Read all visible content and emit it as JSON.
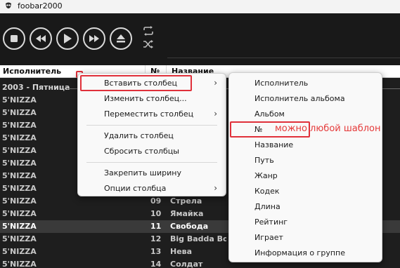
{
  "window": {
    "title": "foobar2000"
  },
  "toolbar": {
    "buttons": [
      {
        "name": "stop-button",
        "icon": "stop-icon"
      },
      {
        "name": "previous-button",
        "icon": "previous-icon"
      },
      {
        "name": "play-button",
        "icon": "play-icon"
      },
      {
        "name": "next-button",
        "icon": "next-icon"
      },
      {
        "name": "eject-button",
        "icon": "eject-icon"
      }
    ],
    "order_icons": [
      "repeat-icon",
      "shuffle-icon"
    ]
  },
  "columns": {
    "artist": "Исполнитель",
    "number": "№",
    "title": "Название"
  },
  "group": {
    "label": "2003 - Пятница"
  },
  "rows": [
    {
      "artist": "5'NIZZA",
      "number": "",
      "title": ""
    },
    {
      "artist": "5'NIZZA",
      "number": "",
      "title": ""
    },
    {
      "artist": "5'NIZZA",
      "number": "",
      "title": ""
    },
    {
      "artist": "5'NIZZA",
      "number": "",
      "title": ""
    },
    {
      "artist": "5'NIZZA",
      "number": "",
      "title": ""
    },
    {
      "artist": "5'NIZZA",
      "number": "",
      "title": ""
    },
    {
      "artist": "5'NIZZA",
      "number": "",
      "title": ""
    },
    {
      "artist": "5'NIZZA",
      "number": "",
      "title": ""
    },
    {
      "artist": "5'NIZZA",
      "number": "09",
      "title": "Стрела"
    },
    {
      "artist": "5'NIZZA",
      "number": "10",
      "title": "Ямайка"
    },
    {
      "artist": "5'NIZZA",
      "number": "11",
      "title": "Свобода"
    },
    {
      "artist": "5'NIZZA",
      "number": "12",
      "title": "Big Badda Boom"
    },
    {
      "artist": "5'NIZZA",
      "number": "13",
      "title": "Нева"
    },
    {
      "artist": "5'NIZZA",
      "number": "14",
      "title": "Солдат"
    }
  ],
  "context_menu": {
    "insert_column": "Вставить столбец",
    "edit_column": "Изменить столбец...",
    "move_column": "Переместить столбец",
    "delete_column": "Удалить столбец",
    "reset_columns": "Сбросить столбцы",
    "pin_width": "Закрепить ширину",
    "column_options": "Опции столбца",
    "submenu_arrow": "›"
  },
  "submenu": {
    "items": [
      "Исполнитель",
      "Исполнитель альбома",
      "Альбом",
      "№",
      "Название",
      "Путь",
      "Жанр",
      "Кодек",
      "Длина",
      "Рейтинг",
      "Играет",
      "Информация о группе"
    ]
  },
  "annotation": {
    "text": "можно любой шаблон",
    "color": "#e53a3a"
  },
  "colors": {
    "background": "#1b1b1b",
    "selected_row": "#3a3a3a",
    "highlight_box": "#e0303a"
  }
}
